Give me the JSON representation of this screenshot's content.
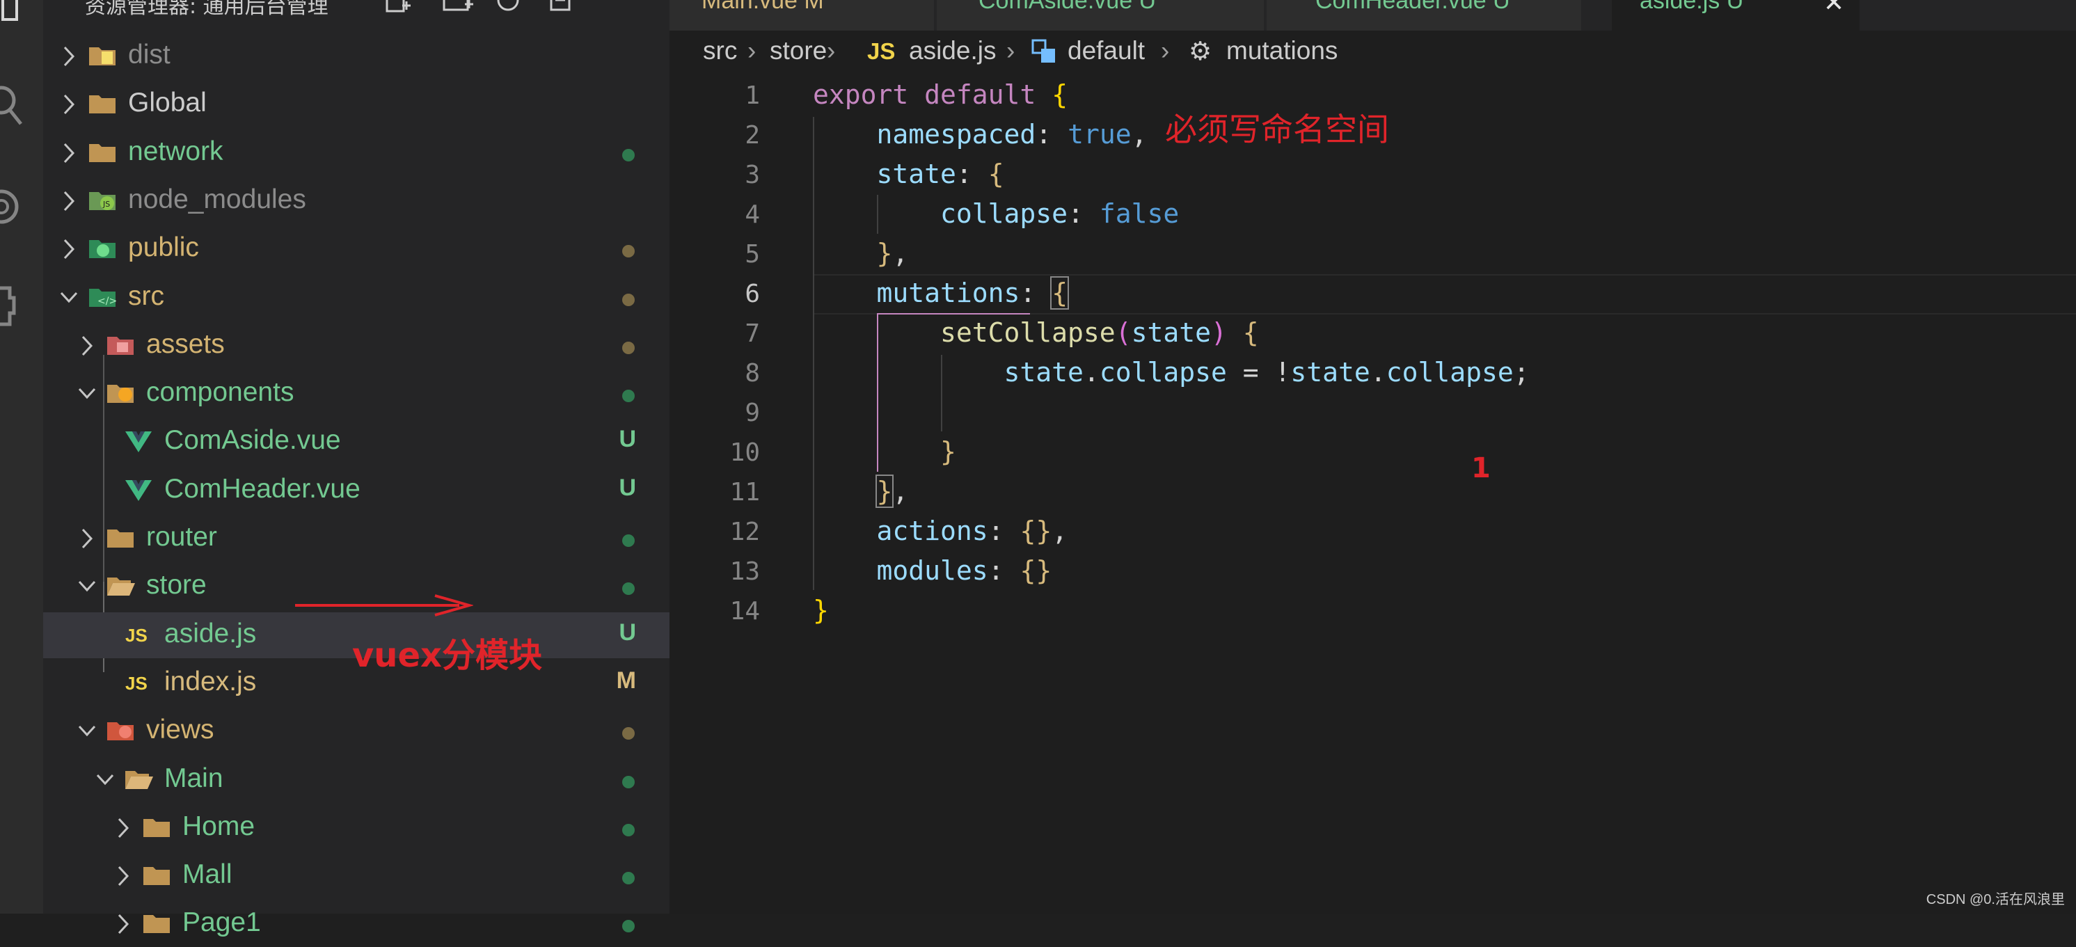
{
  "explorer": {
    "title": "资源管理器: 通用后台管理",
    "items": [
      {
        "name": "dist",
        "color": "#8c8c8c"
      },
      {
        "name": "Global",
        "color": "#cccccc"
      },
      {
        "name": "network",
        "color": "#73c991"
      },
      {
        "name": "node_modules",
        "color": "#8c8c8c"
      },
      {
        "name": "public",
        "color": "#d4b472"
      },
      {
        "name": "src",
        "color": "#d4b472"
      },
      {
        "name": "assets",
        "color": "#d4b472"
      },
      {
        "name": "components",
        "color": "#73c991"
      },
      {
        "name": "ComAside.vue",
        "color": "#73c991",
        "badge": "U"
      },
      {
        "name": "ComHeader.vue",
        "color": "#73c991",
        "badge": "U"
      },
      {
        "name": "router",
        "color": "#73c991"
      },
      {
        "name": "store",
        "color": "#73c991"
      },
      {
        "name": "aside.js",
        "color": "#73c991",
        "badge": "U"
      },
      {
        "name": "index.js",
        "color": "#d7ba7d",
        "badge": "M"
      },
      {
        "name": "views",
        "color": "#d4b472"
      },
      {
        "name": "Main",
        "color": "#73c991"
      },
      {
        "name": "Home",
        "color": "#73c991"
      },
      {
        "name": "Mall",
        "color": "#73c991"
      },
      {
        "name": "Page1",
        "color": "#73c991"
      }
    ]
  },
  "tabs": [
    {
      "label": "Main.vue  M"
    },
    {
      "label": "ComAside.vue  U"
    },
    {
      "label": "ComHeader.vue  U"
    },
    {
      "label": "aside.js  U"
    }
  ],
  "breadcrumb": {
    "parts": [
      "src",
      "store",
      "JS",
      "aside.js",
      "default",
      "mutations"
    ]
  },
  "editor": {
    "line_numbers": [
      "1",
      "2",
      "3",
      "4",
      "5",
      "6",
      "7",
      "8",
      "9",
      "10",
      "11",
      "12",
      "13",
      "14"
    ]
  },
  "annotations": {
    "namespace_note": "必须写命名空间",
    "vuex_note": "vuex分模块",
    "marker": "1"
  },
  "watermark": "CSDN @0.活在风浪里",
  "colors": {
    "added": "#73c991",
    "modified": "#d7ba7d",
    "ignored": "#8c8c8c",
    "annotation": "#e0242a"
  }
}
